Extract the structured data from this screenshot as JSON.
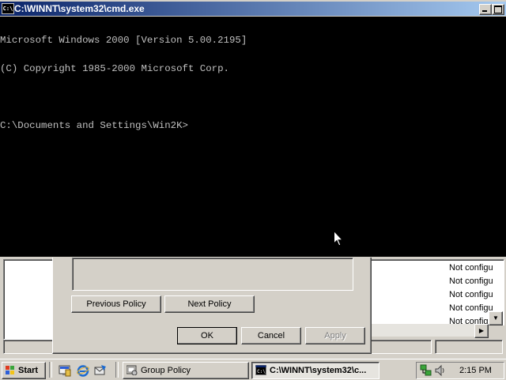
{
  "cmd_window": {
    "title": "C:\\WINNT\\system32\\cmd.exe",
    "icon": "cmd-icon",
    "console_lines": [
      "Microsoft Windows 2000 [Version 5.00.2195]",
      "(C) Copyright 1985-2000 Microsoft Corp.",
      "",
      "C:\\Documents and Settings\\Win2K>"
    ]
  },
  "policy_dialog": {
    "previous_label": "Previous Policy",
    "next_label": "Next Policy",
    "ok_label": "OK",
    "cancel_label": "Cancel",
    "apply_label": "Apply"
  },
  "mmc": {
    "right_pane_items": [
      "Not configu",
      "Not configu",
      "Not configu",
      "Not configu",
      "Not configu"
    ]
  },
  "taskbar": {
    "start_label": "Start",
    "quick_launch": [
      "show-desktop-icon",
      "internet-explorer-icon",
      "outlook-express-icon"
    ],
    "tasks": [
      {
        "label": "Group Policy",
        "icon": "group-policy-icon"
      },
      {
        "label": "C:\\WINNT\\system32\\c...",
        "icon": "cmd-icon"
      }
    ],
    "tray_icons": [
      "network-icon",
      "volume-icon"
    ],
    "clock": "2:15 PM"
  },
  "colors": {
    "titlebar_start": "#0a246a",
    "titlebar_end": "#a6caf0",
    "console_bg": "#000000",
    "console_fg": "#c0c0c0",
    "face": "#d4d0c8"
  }
}
